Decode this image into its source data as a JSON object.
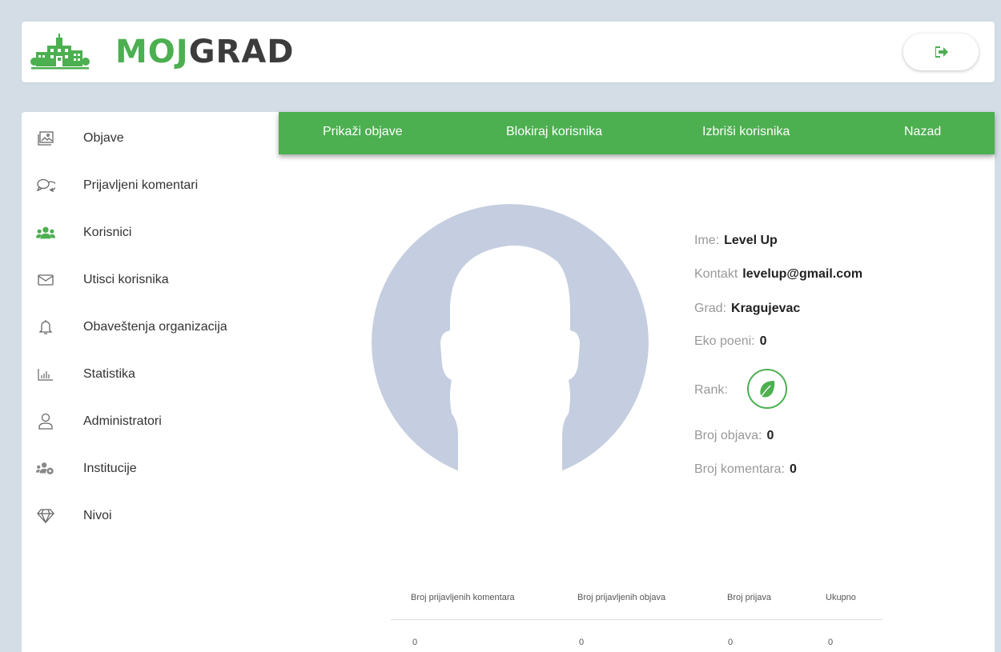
{
  "header": {
    "logo_part1": "MOJ",
    "logo_part2": "GRAD",
    "logout_icon": "sign-out-icon"
  },
  "sidebar": {
    "items": [
      {
        "label": "Objave",
        "icon": "image-icon"
      },
      {
        "label": "Prijavljeni komentari",
        "icon": "comments-icon"
      },
      {
        "label": "Korisnici",
        "icon": "users-icon"
      },
      {
        "label": "Utisci korisnika",
        "icon": "envelope-icon"
      },
      {
        "label": "Obaveštenja organizacija",
        "icon": "bell-icon"
      },
      {
        "label": "Statistika",
        "icon": "bar-chart-icon"
      },
      {
        "label": "Administratori",
        "icon": "user-icon"
      },
      {
        "label": "Institucije",
        "icon": "users-cog-icon"
      },
      {
        "label": "Nivoi",
        "icon": "gem-icon"
      }
    ],
    "active_index": 2
  },
  "topnav": {
    "items": [
      "Prikaži objave",
      "Blokiraj korisnika",
      "Izbriši korisnika",
      "Nazad"
    ]
  },
  "profile": {
    "name_label": "Ime:",
    "name": "Level Up",
    "contact_label": "Kontakt",
    "contact": "levelup@gmail.com",
    "city_label": "Grad:",
    "city": "Kragujevac",
    "points_label": "Eko poeni:",
    "points": "0",
    "rank_label": "Rank:",
    "rank_icon": "leaf-icon",
    "posts_label": "Broj objava:",
    "posts": "0",
    "comments_label": "Broj komentara:",
    "comments": "0"
  },
  "stats": {
    "headers": [
      "Broj prijavljenih komentara",
      "Broj prijavljenih objava",
      "Broj prijava",
      "Ukupno"
    ],
    "values": [
      "0",
      "0",
      "0",
      "0"
    ]
  },
  "colors": {
    "accent": "#4caf50",
    "background": "#d4dde5",
    "avatar": "#c5cee0"
  }
}
